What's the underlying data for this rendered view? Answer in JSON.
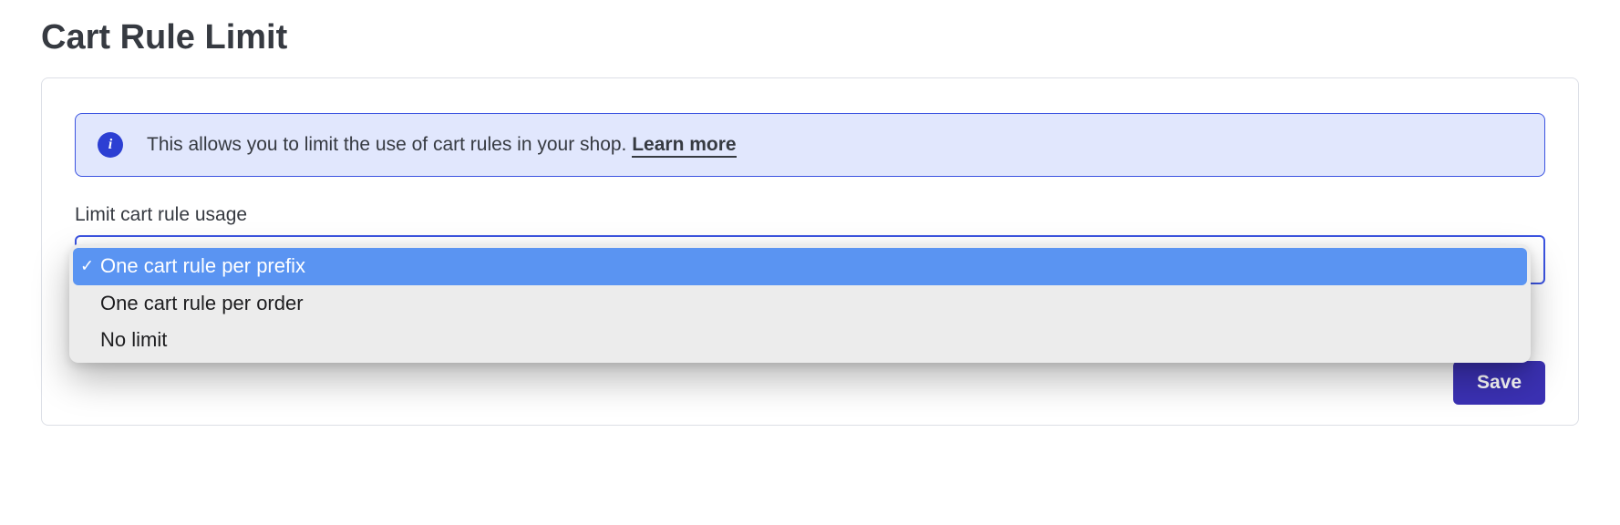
{
  "page": {
    "title": "Cart Rule Limit"
  },
  "info": {
    "icon_letter": "i",
    "text": "This allows you to limit the use of cart rules in your shop. ",
    "link_label": "Learn more"
  },
  "field": {
    "label": "Limit cart rule usage"
  },
  "dropdown": {
    "options": [
      {
        "label": "One cart rule per prefix",
        "selected": true
      },
      {
        "label": "One cart rule per order",
        "selected": false
      },
      {
        "label": "No limit",
        "selected": false
      }
    ]
  },
  "actions": {
    "save_label": "Save"
  }
}
